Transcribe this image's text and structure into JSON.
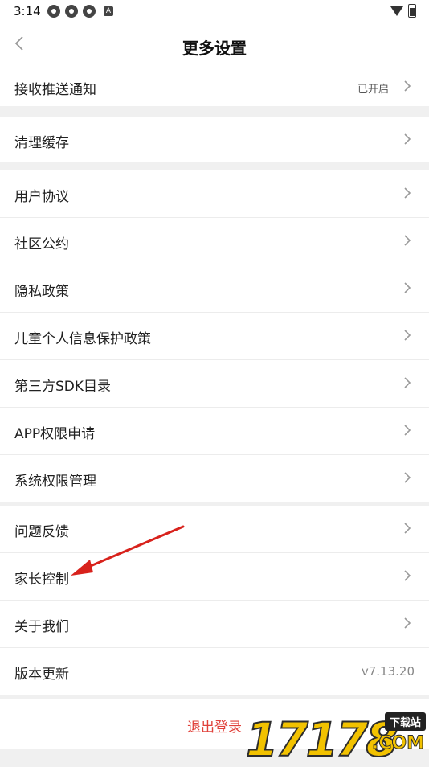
{
  "status": {
    "time": "3:14",
    "badge": "A"
  },
  "header": {
    "title": "更多设置"
  },
  "groups": {
    "g1": [
      {
        "label": "接收推送通知",
        "value": "已开启"
      }
    ],
    "g2": [
      {
        "label": "清理缓存"
      }
    ],
    "g3": [
      {
        "label": "用户协议"
      },
      {
        "label": "社区公约"
      },
      {
        "label": "隐私政策"
      },
      {
        "label": "儿童个人信息保护政策"
      },
      {
        "label": "第三方SDK目录"
      },
      {
        "label": "APP权限申请"
      },
      {
        "label": "系统权限管理"
      }
    ],
    "g4": [
      {
        "label": "问题反馈"
      },
      {
        "label": "家长控制"
      },
      {
        "label": "关于我们"
      },
      {
        "label": "版本更新",
        "value": "v7.13.20"
      }
    ]
  },
  "logout": {
    "label": "退出登录"
  },
  "watermark": {
    "number": "17178",
    "tag": "下载站",
    "com": ".COM"
  },
  "colors": {
    "accent_red": "#e0413a",
    "watermark_yellow": "#f2c200"
  },
  "icons": {
    "back": "chevron-left-icon",
    "row": "chevron-right-icon"
  }
}
